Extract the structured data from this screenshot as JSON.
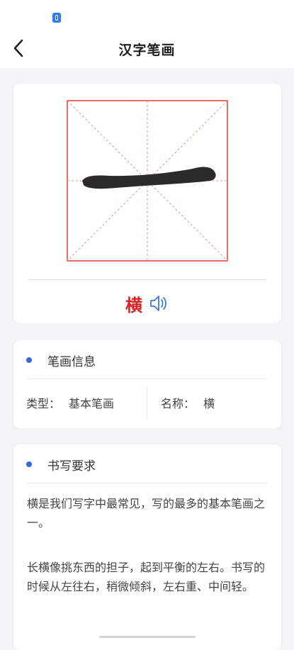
{
  "app": {
    "title": "汉字笔画"
  },
  "status": {
    "icon": "bluetooth-icon",
    "accent": "#2f7cf6"
  },
  "nav": {
    "back_icon": "chevron-left-icon"
  },
  "stroke": {
    "name": "横",
    "color": "#e02020",
    "speaker_icon": "speaker-icon"
  },
  "info": {
    "title": "笔画信息",
    "type_label": "类型：",
    "type_value": "基本笔画",
    "name_label": "名称：",
    "name_value": "横"
  },
  "requirements": {
    "title": "书写要求",
    "paragraph1": "横是我们写字中最常见，写的最多的基本笔画之一。",
    "paragraph2": "长横像挑东西的担子，起到平衡的左右。书写的时候从左往右，稍微倾斜，左右重、中间轻。"
  }
}
